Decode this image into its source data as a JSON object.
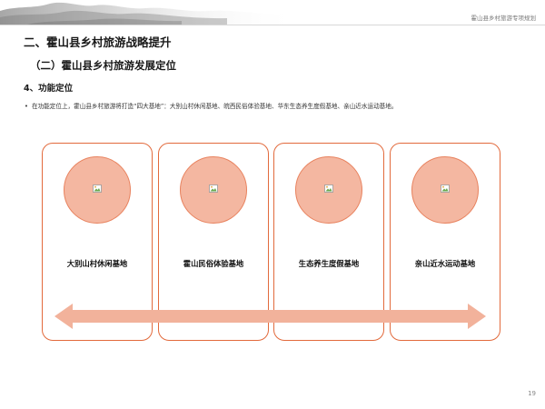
{
  "header": {
    "title": "霍山县乡村旅游专项规划"
  },
  "section": {
    "heading_1": "二、霍山县乡村旅游战略提升",
    "heading_2": "（二）霍山县乡村旅游发展定位",
    "heading_3": "4、功能定位",
    "bullet_marker": "•",
    "bullet_text": "在功能定位上，霍山县乡村旅游将打造“四大基地”：大别山村休闲基地、皖西民俗体验基地、华东生态养生度假基地、亲山近水运动基地。"
  },
  "cards": [
    {
      "label": "大别山村休闲基地",
      "icon": "image-placeholder-icon"
    },
    {
      "label": "霍山民俗体验基地",
      "icon": "image-placeholder-icon"
    },
    {
      "label": "生态养生度假基地",
      "icon": "image-placeholder-icon"
    },
    {
      "label": "亲山近水运动基地",
      "icon": "image-placeholder-icon"
    }
  ],
  "decor": {
    "header_icon": "ink-landscape-icon",
    "arrow_icon": "double-headed-arrow-icon"
  },
  "colors": {
    "accent": "#e26a3c",
    "circle_fill": "#f4b7a1",
    "arrow_fill": "#f2b29b"
  },
  "footer": {
    "page_number": "19"
  }
}
